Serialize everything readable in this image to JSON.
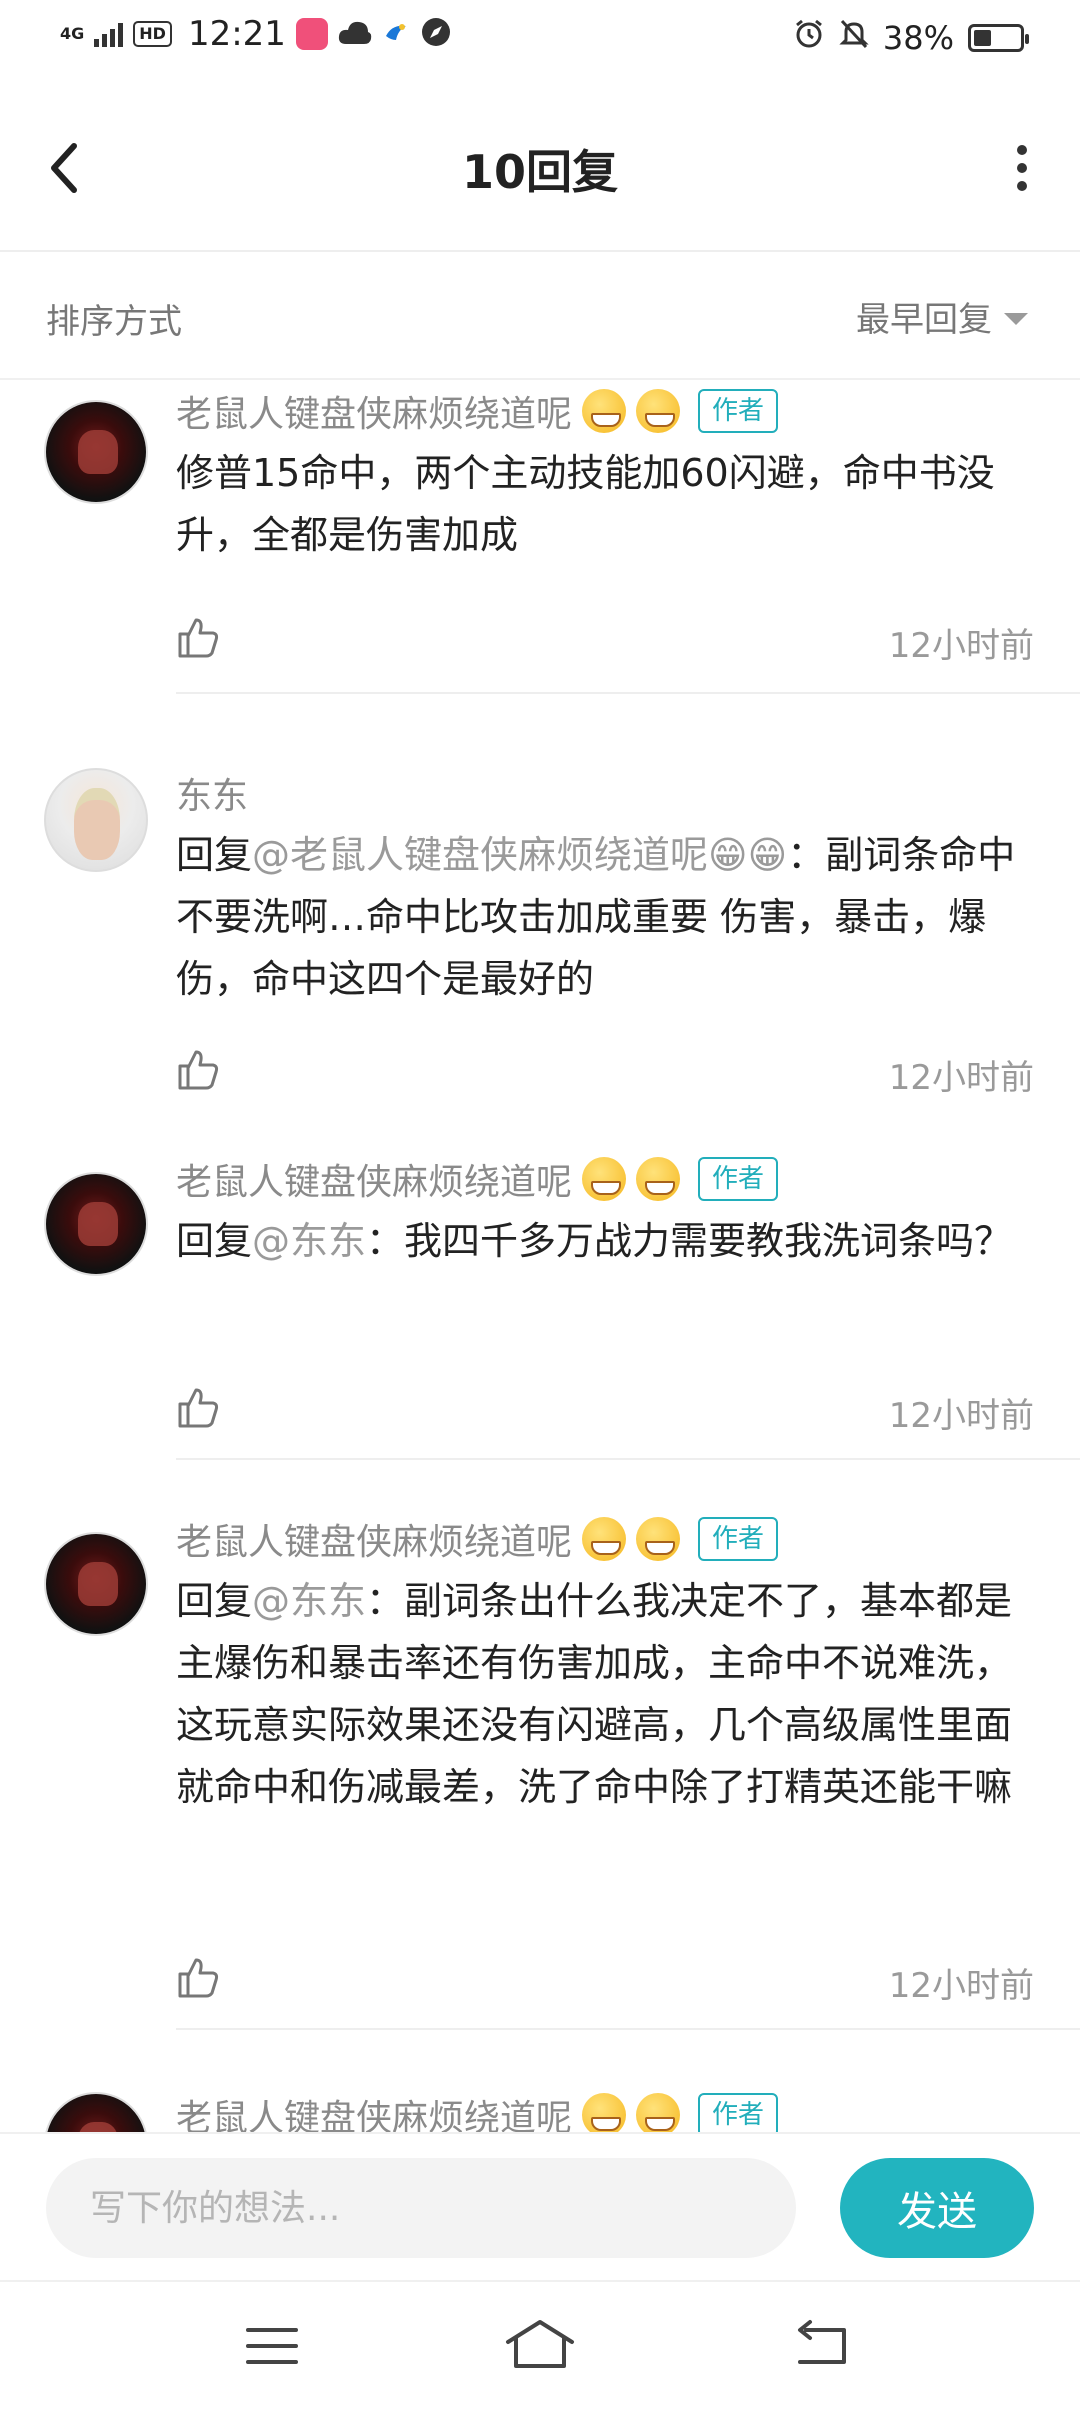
{
  "status_bar": {
    "network": "4G",
    "hd": "HD",
    "time": "12:21",
    "battery_text": "38%",
    "battery_level": 0.38
  },
  "header": {
    "title": "10回复"
  },
  "sort": {
    "label": "排序方式",
    "selected": "最早回复"
  },
  "comments": [
    {
      "author": "老鼠人键盘侠麻烦绕道呢",
      "badge": "作者",
      "reply_prefix": "",
      "reply_to": "",
      "reply_sep": "",
      "text": "修普15命中，两个主动技能加60闪避，命中书没升，全都是伤害加成",
      "time": "12小时前"
    },
    {
      "author": "东东",
      "badge": "",
      "reply_prefix": "回复",
      "reply_to": "@老鼠人键盘侠麻烦绕道呢😁😁",
      "reply_sep": "：",
      "text": "副词条命中不要洗啊…命中比攻击加成重要  伤害，暴击，爆伤，命中这四个是最好的",
      "time": "12小时前"
    },
    {
      "author": "老鼠人键盘侠麻烦绕道呢",
      "badge": "作者",
      "reply_prefix": "回复",
      "reply_to": "@东东",
      "reply_sep": "：",
      "text": "我四千多万战力需要教我洗词条吗？",
      "time": "12小时前"
    },
    {
      "author": "老鼠人键盘侠麻烦绕道呢",
      "badge": "作者",
      "reply_prefix": "回复",
      "reply_to": "@东东",
      "reply_sep": "：",
      "text": "副词条出什么我决定不了，基本都是主爆伤和暴击率还有伤害加成，主命中不说难洗，这玩意实际效果还没有闪避高，几个高级属性里面就命中和伤减最差，洗了命中除了打精英还能干嘛",
      "time": "12小时前"
    },
    {
      "author": "老鼠人键盘侠麻烦绕道呢",
      "badge": "作者"
    }
  ],
  "input": {
    "placeholder": "写下你的想法..."
  },
  "send": {
    "label": "发送"
  },
  "icons": {
    "back": "back-arrow-icon",
    "more": "more-vertical-icon",
    "like": "thumbs-up-icon",
    "nav_menu": "menu-icon",
    "nav_home": "home-icon",
    "nav_back": "return-icon"
  },
  "colors": {
    "accent": "#22b4bf",
    "badge": "#22aebb"
  }
}
